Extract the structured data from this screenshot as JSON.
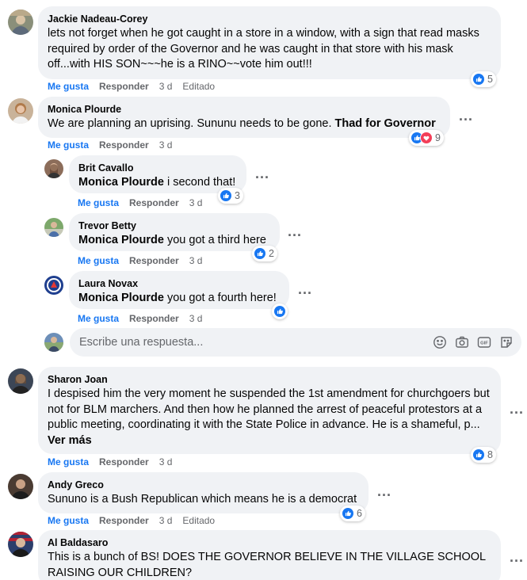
{
  "labels": {
    "like": "Me gusta",
    "reply": "Responder",
    "edited": "Editado",
    "see_more": "Ver más",
    "more_options": "..."
  },
  "colors": {
    "like_blue": "#1877f2",
    "love_red": "#f33e58",
    "bubble": "#f0f2f5",
    "meta_gray": "#65676b"
  },
  "comments": [
    {
      "author": "Jackie Nadeau-Corey",
      "text": "lets not forget when he got caught in a store in a window, with a sign that read masks required by order of the Governor and he was caught in that store with his mask off...with HIS SON~~~he is a RINO~~vote him out!!!",
      "time": "3 d",
      "edited": true,
      "reactions": [
        "like"
      ],
      "reaction_count": "5"
    },
    {
      "author": "Monica Plourde",
      "text": "We are planning an uprising. Sununu needs to be gone. ",
      "text_bold": "Thad for Governor",
      "time": "3 d",
      "reactions": [
        "like",
        "love"
      ],
      "reaction_count": "9",
      "replies": [
        {
          "author": "Brit Cavallo",
          "mention": "Monica Plourde",
          "text": " i second that!",
          "time": "3 d",
          "reactions": [
            "like"
          ],
          "reaction_count": "3"
        },
        {
          "author": "Trevor Betty",
          "mention": "Monica Plourde",
          "text": " you got a third here",
          "time": "3 d",
          "reactions": [
            "like"
          ],
          "reaction_count": "2"
        },
        {
          "author": "Laura Novax",
          "mention": "Monica Plourde",
          "text": " you got a fourth here!",
          "time": "3 d",
          "reactions": [
            "like"
          ],
          "reaction_count": ""
        }
      ],
      "reply_placeholder": "Escribe una respuesta..."
    },
    {
      "author": "Sharon Joan",
      "text": "I despised him the very moment he suspended the 1st amendment for churchgoers but not for BLM marchers. And then how he planned the arrest of peaceful protestors at a public meeting, coordinating it with the State Police in advance. He is a shameful, p... ",
      "time": "3 d",
      "reactions": [
        "like"
      ],
      "reaction_count": "8"
    },
    {
      "author": "Andy Greco",
      "text": "Sununo is a Bush Republican which means he is a democrat",
      "time": "3 d",
      "edited": true,
      "reactions": [
        "like"
      ],
      "reaction_count": "6"
    },
    {
      "author": "Al Baldasaro",
      "text": "This is a bunch of BS! DOES THE GOVERNOR BELIEVE IN THE VILLAGE SCHOOL RAISING OUR CHILDREN?"
    }
  ],
  "composer_icons": [
    "smiley-icon",
    "camera-icon",
    "gif-icon",
    "sticker-icon"
  ]
}
